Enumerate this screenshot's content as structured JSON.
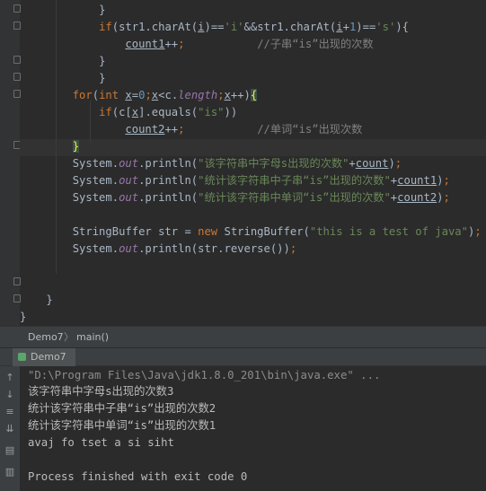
{
  "editor": {
    "lines": [
      {
        "indent": "            ",
        "tokens": [
          {
            "t": "}",
            "c": ""
          }
        ]
      },
      {
        "indent": "            ",
        "tokens": [
          {
            "t": "if",
            "c": "kw"
          },
          {
            "t": "(str1.charAt(",
            "c": ""
          },
          {
            "t": "i",
            "c": "ul"
          },
          {
            "t": ")==",
            "c": ""
          },
          {
            "t": "'i'",
            "c": "st"
          },
          {
            "t": "&&str1.charAt(",
            "c": ""
          },
          {
            "t": "i",
            "c": "ul"
          },
          {
            "t": "+",
            "c": ""
          },
          {
            "t": "1",
            "c": "nm"
          },
          {
            "t": ")==",
            "c": ""
          },
          {
            "t": "'s'",
            "c": "st"
          },
          {
            "t": "){",
            "c": ""
          }
        ]
      },
      {
        "indent": "                ",
        "tokens": [
          {
            "t": "count1",
            "c": "ul"
          },
          {
            "t": "++",
            "c": ""
          },
          {
            "t": ";",
            "c": "kw"
          },
          {
            "t": "           ",
            "c": ""
          },
          {
            "t": "//子串“is”出现的次数",
            "c": "cm"
          }
        ]
      },
      {
        "indent": "            ",
        "tokens": [
          {
            "t": "}",
            "c": ""
          }
        ]
      },
      {
        "indent": "            ",
        "tokens": [
          {
            "t": "}",
            "c": ""
          }
        ]
      },
      {
        "indent": "        ",
        "tokens": [
          {
            "t": "for",
            "c": "kw"
          },
          {
            "t": "(",
            "c": ""
          },
          {
            "t": "int ",
            "c": "kw"
          },
          {
            "t": "x",
            "c": "ul"
          },
          {
            "t": "=",
            "c": ""
          },
          {
            "t": "0",
            "c": "nm"
          },
          {
            "t": ";",
            "c": "kw"
          },
          {
            "t": "x",
            "c": "ul"
          },
          {
            "t": "<c.",
            "c": ""
          },
          {
            "t": "length",
            "c": "fd"
          },
          {
            "t": ";",
            "c": "kw"
          },
          {
            "t": "x",
            "c": "ul"
          },
          {
            "t": "++)",
            "c": ""
          },
          {
            "t": "{",
            "c": "bracehl"
          }
        ]
      },
      {
        "indent": "            ",
        "tokens": [
          {
            "t": "if",
            "c": "kw"
          },
          {
            "t": "(c[",
            "c": ""
          },
          {
            "t": "x",
            "c": "ul"
          },
          {
            "t": "].equals(",
            "c": ""
          },
          {
            "t": "\"is\"",
            "c": "st"
          },
          {
            "t": "))",
            "c": ""
          }
        ]
      },
      {
        "indent": "                ",
        "tokens": [
          {
            "t": "count2",
            "c": "ul"
          },
          {
            "t": "++",
            "c": ""
          },
          {
            "t": ";",
            "c": "kw"
          },
          {
            "t": "           ",
            "c": ""
          },
          {
            "t": "//单词“is”出现次数",
            "c": "cm"
          }
        ]
      },
      {
        "indent": "        ",
        "tokens": [
          {
            "t": "}",
            "c": "bracehl"
          }
        ]
      },
      {
        "indent": "        ",
        "tokens": [
          {
            "t": "System.",
            "c": ""
          },
          {
            "t": "out",
            "c": "fd"
          },
          {
            "t": ".println(",
            "c": ""
          },
          {
            "t": "\"该字符串中字母s出现的次数\"",
            "c": "st"
          },
          {
            "t": "+",
            "c": ""
          },
          {
            "t": "count",
            "c": "ul"
          },
          {
            "t": ")",
            "c": ""
          },
          {
            "t": ";",
            "c": "kw"
          }
        ]
      },
      {
        "indent": "        ",
        "tokens": [
          {
            "t": "System.",
            "c": ""
          },
          {
            "t": "out",
            "c": "fd"
          },
          {
            "t": ".println(",
            "c": ""
          },
          {
            "t": "\"统计该字符串中子串“is”出现的次数\"",
            "c": "st"
          },
          {
            "t": "+",
            "c": ""
          },
          {
            "t": "count1",
            "c": "ul"
          },
          {
            "t": ")",
            "c": ""
          },
          {
            "t": ";",
            "c": "kw"
          }
        ]
      },
      {
        "indent": "        ",
        "tokens": [
          {
            "t": "System.",
            "c": ""
          },
          {
            "t": "out",
            "c": "fd"
          },
          {
            "t": ".println(",
            "c": ""
          },
          {
            "t": "\"统计该字符串中单词“is”出现的次数\"",
            "c": "st"
          },
          {
            "t": "+",
            "c": ""
          },
          {
            "t": "count2",
            "c": "ul"
          },
          {
            "t": ")",
            "c": ""
          },
          {
            "t": ";",
            "c": "kw"
          }
        ]
      },
      {
        "indent": "",
        "tokens": []
      },
      {
        "indent": "        ",
        "tokens": [
          {
            "t": "StringBuffer str = ",
            "c": ""
          },
          {
            "t": "new ",
            "c": "kw"
          },
          {
            "t": "StringBuffer(",
            "c": ""
          },
          {
            "t": "\"this is a test of java\"",
            "c": "st"
          },
          {
            "t": ")",
            "c": ""
          },
          {
            "t": ";",
            "c": "kw"
          }
        ]
      },
      {
        "indent": "        ",
        "tokens": [
          {
            "t": "System.",
            "c": ""
          },
          {
            "t": "out",
            "c": "fd"
          },
          {
            "t": ".println(str.reverse())",
            "c": ""
          },
          {
            "t": ";",
            "c": "kw"
          }
        ]
      },
      {
        "indent": "",
        "tokens": []
      },
      {
        "indent": "",
        "tokens": []
      },
      {
        "indent": "    ",
        "tokens": [
          {
            "t": "}",
            "c": ""
          }
        ]
      },
      {
        "indent": "",
        "tokens": [
          {
            "t": "}",
            "c": ""
          }
        ]
      }
    ]
  },
  "breadcrumb": {
    "class_name": "Demo7",
    "method": "main()"
  },
  "run_panel": {
    "tab_label": "Demo7"
  },
  "console": {
    "command": "\"D:\\Program Files\\Java\\jdk1.8.0_201\\bin\\java.exe\" ...",
    "output": [
      "该字符串中字母s出现的次数3",
      "统计该字符串中子串“is”出现的次数2",
      "统计该字符串中单词“is”出现的次数1",
      "avaj fo tset a si siht"
    ],
    "exit_message": "Process finished with exit code 0"
  },
  "console_toolbar": {
    "icons": [
      "arrow-up-icon",
      "arrow-down-icon",
      "soft-wrap-icon",
      "scroll-to-end-icon",
      "print-icon",
      "trash-icon"
    ]
  }
}
